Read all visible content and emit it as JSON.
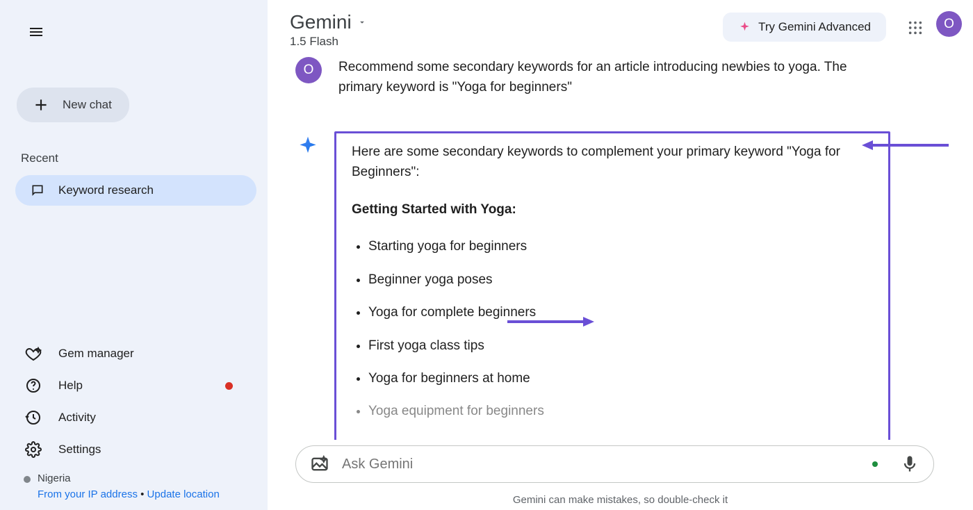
{
  "brand": {
    "name": "Gemini",
    "model": "1.5 Flash"
  },
  "sidebar": {
    "new_chat": "New chat",
    "recent_label": "Recent",
    "chats": [
      "Keyword research"
    ],
    "items": [
      {
        "label": "Gem manager"
      },
      {
        "label": "Help"
      },
      {
        "label": "Activity"
      },
      {
        "label": "Settings"
      }
    ],
    "location": {
      "country": "Nigeria",
      "ip": "From your IP address",
      "update": "Update location"
    }
  },
  "header": {
    "advanced": "Try Gemini Advanced",
    "avatar": "O"
  },
  "conversation": {
    "user_avatar": "O",
    "user_text": "Recommend some secondary keywords for an article introducing newbies to yoga. The primary keyword is \"Yoga for beginners\"",
    "ai_intro": "Here are some secondary keywords to complement your primary keyword \"Yoga for Beginners\":",
    "ai_section": "Getting Started with Yoga:",
    "ai_bullets": [
      "Starting yoga for beginners",
      "Beginner yoga poses",
      "Yoga for complete beginners",
      "First yoga class tips",
      "Yoga for beginners at home",
      "Yoga equipment for beginners"
    ]
  },
  "input": {
    "placeholder": "Ask Gemini"
  },
  "disclaimer": "Gemini can make mistakes, so double-check it"
}
